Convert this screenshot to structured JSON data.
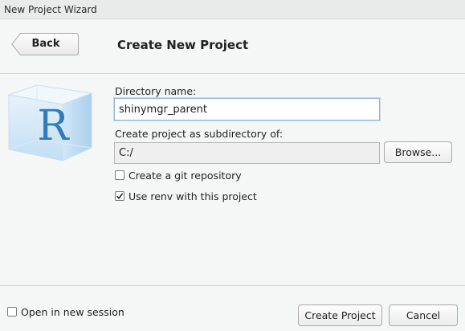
{
  "window": {
    "title": "New Project Wizard"
  },
  "header": {
    "back_label": "Back",
    "page_title": "Create New Project"
  },
  "form": {
    "directory_name": {
      "label": "Directory name:",
      "value": "shinymgr_parent"
    },
    "subdirectory": {
      "label": "Create project as subdirectory of:",
      "value": "C:/",
      "browse_label": "Browse..."
    },
    "git_repo": {
      "label": "Create a git repository",
      "checked": false
    },
    "renv": {
      "label": "Use renv with this project",
      "checked": true
    }
  },
  "footer": {
    "open_new_session": {
      "label": "Open in new session",
      "checked": false
    },
    "create_label": "Create Project",
    "cancel_label": "Cancel"
  },
  "icons": {
    "logo": "r-cube-logo",
    "back": "back-arrow-shape",
    "check": "check-mark-icon"
  },
  "colors": {
    "logo_letter": "#2f7bbd",
    "logo_cube": "#c6e0f4",
    "focus_border": "#8eb4d6"
  }
}
